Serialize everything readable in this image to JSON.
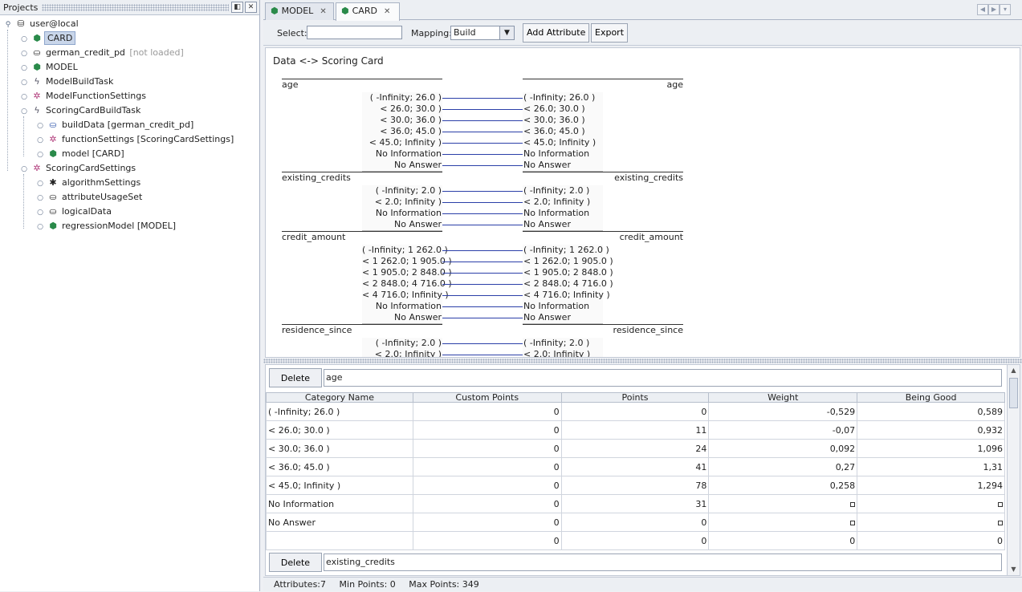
{
  "projects": {
    "title": "Projects",
    "tree": [
      {
        "label": "user@local",
        "icon": "database-icon",
        "suffix": ""
      },
      {
        "label": "CARD",
        "icon": "cube-icon",
        "suffix": ""
      },
      {
        "label": "german_credit_pd",
        "icon": "data-icon",
        "suffix": "[not loaded]"
      },
      {
        "label": "MODEL",
        "icon": "cube-icon",
        "suffix": ""
      },
      {
        "label": "ModelBuildTask",
        "icon": "task-icon",
        "suffix": ""
      },
      {
        "label": "ModelFunctionSettings",
        "icon": "settings-icon",
        "suffix": ""
      },
      {
        "label": "ScoringCardBuildTask",
        "icon": "task-icon",
        "suffix": ""
      },
      {
        "label": "buildData [german_credit_pd]",
        "icon": "data-link-icon",
        "suffix": ""
      },
      {
        "label": "functionSettings [ScoringCardSettings]",
        "icon": "settings-icon",
        "suffix": ""
      },
      {
        "label": "model [CARD]",
        "icon": "cube-link-icon",
        "suffix": ""
      },
      {
        "label": "ScoringCardSettings",
        "icon": "settings-icon",
        "suffix": ""
      },
      {
        "label": "algorithmSettings",
        "icon": "gear-icon",
        "suffix": ""
      },
      {
        "label": "attributeUsageSet",
        "icon": "data-icon",
        "suffix": ""
      },
      {
        "label": "logicalData",
        "icon": "data-icon",
        "suffix": ""
      },
      {
        "label": "regressionModel [MODEL]",
        "icon": "cube-link-icon",
        "suffix": ""
      }
    ]
  },
  "tabs": [
    {
      "label": "MODEL",
      "close": "✕"
    },
    {
      "label": "CARD",
      "close": "✕"
    }
  ],
  "toolbar": {
    "select_label": "Select:",
    "select_value": "",
    "mapping_label": "Mapping:",
    "mapping_value": "Build",
    "add_attribute": "Add Attribute",
    "export": "Export"
  },
  "diagram": {
    "title": "Data <-> Scoring Card",
    "groups": [
      {
        "name": "age",
        "categories": [
          "( -Infinity; 26.0 )",
          "< 26.0; 30.0 )",
          "< 30.0; 36.0 )",
          "< 36.0; 45.0 )",
          "< 45.0; Infinity )",
          "No Information",
          "No Answer"
        ]
      },
      {
        "name": "existing_credits",
        "categories": [
          "( -Infinity; 2.0 )",
          "< 2.0; Infinity )",
          "No Information",
          "No Answer"
        ]
      },
      {
        "name": "credit_amount",
        "categories": [
          "( -Infinity; 1 262.0 )",
          "< 1 262.0; 1 905.0 )",
          "< 1 905.0; 2 848.0 )",
          "< 2 848.0; 4 716.0 )",
          "< 4 716.0; Infinity )",
          "No Information",
          "No Answer"
        ]
      },
      {
        "name": "residence_since",
        "categories": [
          "( -Infinity; 2.0 )",
          "< 2.0; Infinity )"
        ]
      }
    ]
  },
  "editor": {
    "delete_label": "Delete",
    "attribute": "age",
    "next_attribute": "existing_credits",
    "columns": [
      "Category Name",
      "Custom Points",
      "Points",
      "Weight",
      "Being Good"
    ],
    "rows": [
      [
        "( -Infinity; 26.0 )",
        "0",
        "0",
        "-0,529",
        "0,589"
      ],
      [
        "< 26.0; 30.0 )",
        "0",
        "11",
        "-0,07",
        "0,932"
      ],
      [
        "< 30.0; 36.0 )",
        "0",
        "24",
        "0,092",
        "1,096"
      ],
      [
        "< 36.0; 45.0 )",
        "0",
        "41",
        "0,27",
        "1,31"
      ],
      [
        "< 45.0; Infinity )",
        "0",
        "78",
        "0,258",
        "1,294"
      ],
      [
        "No Information",
        "0",
        "31",
        "",
        ""
      ],
      [
        "No Answer",
        "0",
        "0",
        "",
        ""
      ],
      [
        "",
        "0",
        "0",
        "0",
        "0"
      ]
    ]
  },
  "status": {
    "attributes": "Attributes:7",
    "min_points": "Min Points: 0",
    "max_points": "Max Points: 349"
  }
}
